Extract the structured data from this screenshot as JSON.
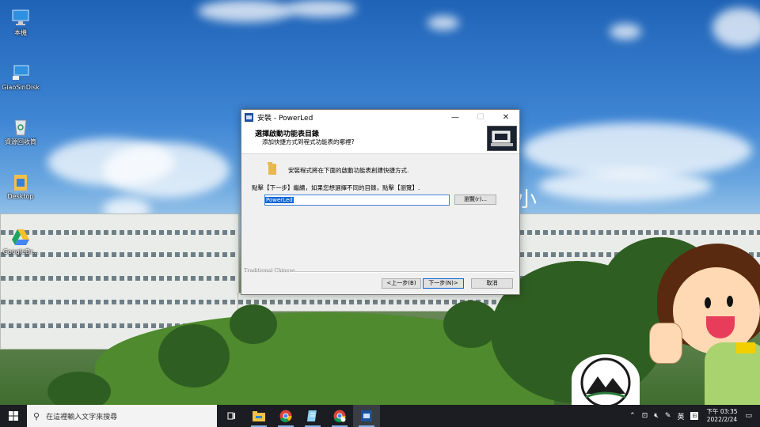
{
  "desktop": {
    "icons": [
      {
        "label": "本機",
        "icon": "computer-icon"
      },
      {
        "label": "GiaoSinDisk",
        "icon": "network-drive-icon"
      },
      {
        "label": "資源回收筒",
        "icon": "recycle-bin-icon"
      },
      {
        "label": "Desktop",
        "icon": "folder-icon"
      },
      {
        "label": "GoogleDr...",
        "icon": "google-drive-icon"
      }
    ],
    "wallpaper_text": "小"
  },
  "dialog": {
    "title": "安裝 - PowerLed",
    "header_title": "選擇啟動功能表目錄",
    "header_subtitle": "添加快捷方式到程式功能表的哪裡?",
    "info_text": "安裝程式將在下面的啟動功能表創建快捷方式.",
    "instruction": "點擊【下一步】繼續，如果您想選擇不同的目錄，點擊【瀏覽】.",
    "folder_value": "PowerLed",
    "browse_label": "瀏覽(r)...",
    "brand": "Traditional Chinese",
    "back_label": "<上一步(B)",
    "next_label": "下一步(N)>",
    "cancel_label": "取消",
    "minimize": "—",
    "maximize": "☐",
    "close": "✕"
  },
  "taskbar": {
    "search_placeholder": "在這裡輸入文字來搜尋",
    "apps": [
      "task-view-icon",
      "file-explorer-icon",
      "chrome-icon",
      "notepad-icon",
      "chrome-alt-icon",
      "powerled-installer-icon"
    ],
    "tray_lang": "英",
    "time": "下午 03:35",
    "date": "2022/2/24"
  },
  "colors": {
    "accent": "#0a64d6",
    "taskbar": "#1b1d22"
  }
}
